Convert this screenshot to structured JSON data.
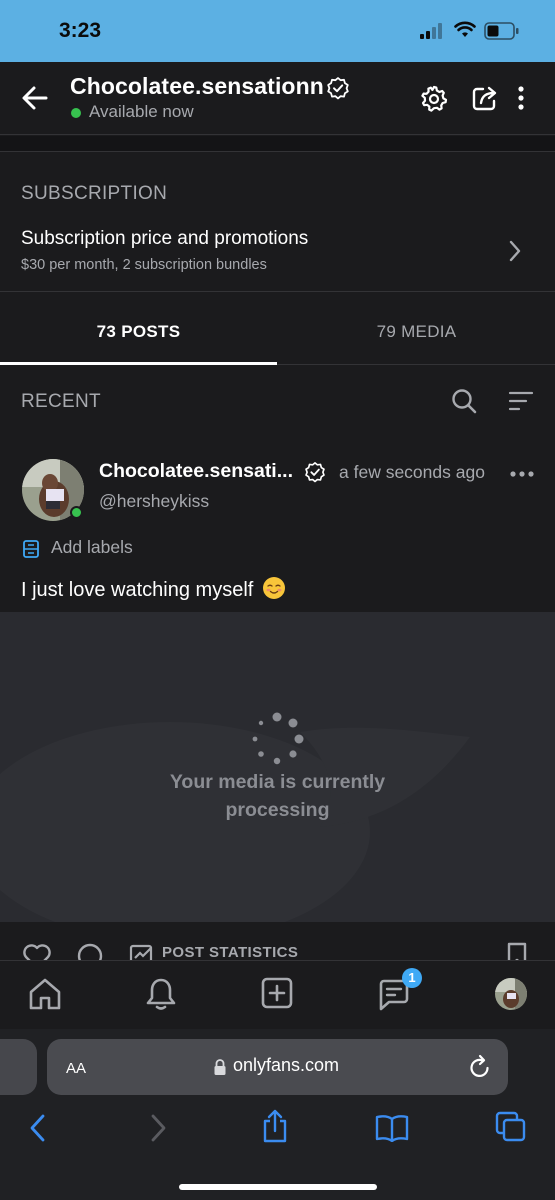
{
  "status_bar": {
    "time": "3:23"
  },
  "header": {
    "profile_name": "Chocolatee.sensationn",
    "availability": "Available now",
    "icons": [
      "back-arrow-icon",
      "verified-icon",
      "gear-icon",
      "share-icon",
      "more-vertical-icon"
    ]
  },
  "subscription": {
    "heading": "SUBSCRIPTION",
    "title": "Subscription price and promotions",
    "detail": "$30 per month, 2 subscription bundles"
  },
  "tabs": [
    {
      "label": "73 POSTS",
      "active": true
    },
    {
      "label": "79 MEDIA",
      "active": false
    }
  ],
  "recent": {
    "label": "RECENT"
  },
  "post": {
    "author": "Chocolatee.sensati...",
    "time": "a few seconds ago",
    "handle": "@hersheykiss",
    "labels_action": "Add labels",
    "text": "I just love watching myself",
    "media_status": "Your media is currently processing"
  },
  "post_actions": {
    "stats_label": "POST STATISTICS"
  },
  "bottom_nav": {
    "items": [
      "home-icon",
      "bell-icon",
      "add-post-icon",
      "messages-icon",
      "profile-avatar"
    ],
    "messages_badge": "1"
  },
  "browser": {
    "aa_label": "AA",
    "url": "onlyfans.com"
  },
  "colors": {
    "status_bar": "#5cb0e3",
    "background": "#1b1b1d",
    "online": "#37c24f",
    "badge": "#3fa9f5",
    "safari_accent": "#3b8cf0"
  }
}
